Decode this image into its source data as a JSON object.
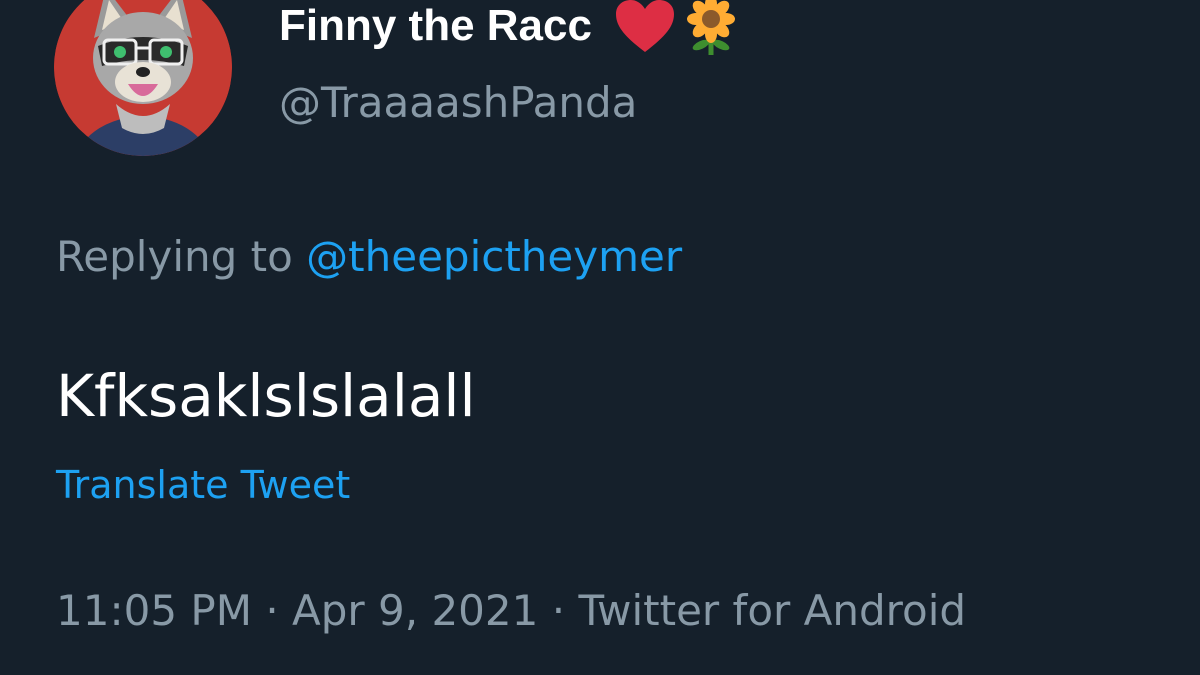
{
  "tweet": {
    "display_name": "Finny the Racc",
    "name_emojis": [
      "heart-icon",
      "sunflower-icon"
    ],
    "handle": "@TraaaashPanda",
    "replying_label": "Replying to",
    "replying_handle": "@theepictheymer",
    "text": "Kfksaklslslalall",
    "translate_label": "Translate Tweet",
    "time": "11:05 PM",
    "separator": "·",
    "date": "Apr 9, 2021",
    "source": "Twitter for Android"
  },
  "colors": {
    "background": "#15202b",
    "primary_text": "#ffffff",
    "secondary_text": "#8899a6",
    "link": "#1da1f2",
    "heart": "#dd2e44",
    "sunflower_petal": "#ffac33",
    "sunflower_center": "#8b5a2b",
    "stem": "#3e8e2f"
  }
}
